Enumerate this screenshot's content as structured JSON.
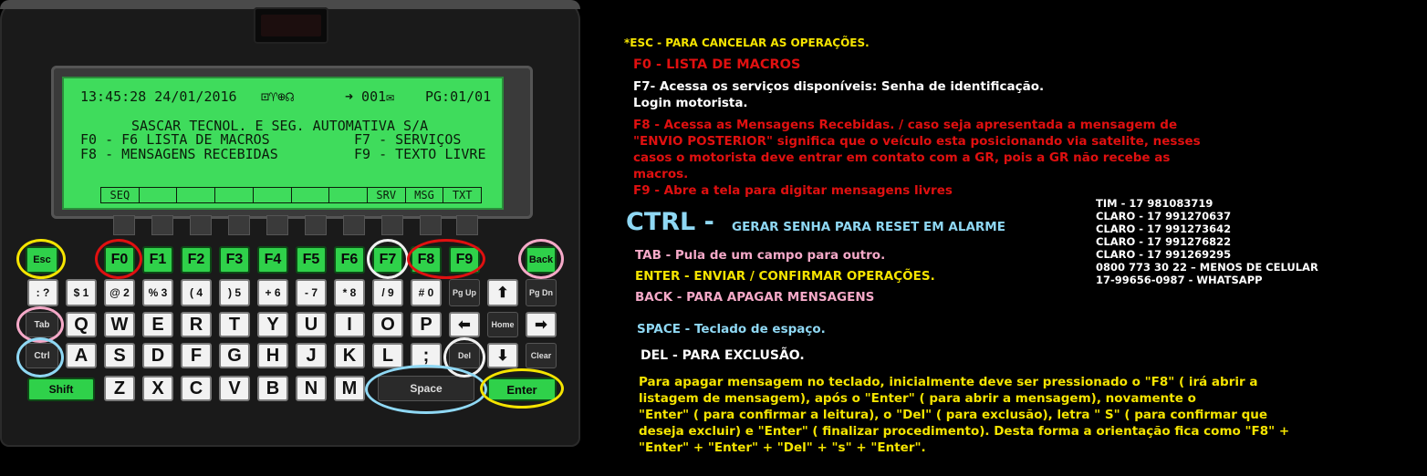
{
  "colors": {
    "yellow": "#f5e400",
    "red": "#e01010",
    "white": "#ffffff",
    "pink": "#f5a9c8",
    "lightblue": "#8fd8f4",
    "lcd": "#3fdc5c",
    "key_green": "#2fd14a"
  },
  "lcd": {
    "status_time": "13:45:28 24/01/2016",
    "status_icons": "⊡♈⊕☊",
    "status_msg": "➜ 001✉",
    "status_page": "PG:01/01",
    "line1": "SASCAR TECNOL. E SEG. AUTOMATIVA S/A",
    "line2_left": "F0 - F6 LISTA DE MACROS",
    "line2_right": "F7 - SERVIÇOS",
    "line3_left": "F8 - MENSAGENS RECEBIDAS",
    "line3_right": "F9 - TEXTO LIVRE",
    "softkeys": [
      "SEQ",
      "",
      "",
      "",
      "",
      "",
      "",
      "SRV",
      "MSG",
      "TXT"
    ]
  },
  "keys": {
    "esc": "Esc",
    "back": "Back",
    "fkeys": [
      "F0",
      "F1",
      "F2",
      "F3",
      "F4",
      "F5",
      "F6",
      "F7",
      "F8",
      "F9"
    ],
    "num_shift": [
      ":",
      "$",
      "@",
      "%",
      "(",
      "+",
      "-",
      "*",
      "/",
      "#"
    ],
    "num": [
      "",
      "1",
      "2",
      "3",
      "4",
      "5",
      "6",
      "7",
      "8",
      "9"
    ],
    "num_row": [
      {
        "s": ":",
        "m": "?"
      },
      {
        "s": "$",
        "m": "1"
      },
      {
        "s": "@",
        "m": "2"
      },
      {
        "s": "%",
        "m": "3"
      },
      {
        "s": "(",
        "m": "4"
      },
      {
        "s": ")",
        "m": "5"
      },
      {
        "s": "+",
        "m": "6"
      },
      {
        "s": "-",
        "m": "7"
      },
      {
        "s": "*",
        "m": "8"
      },
      {
        "s": "/",
        "m": "9"
      },
      {
        "s": "#",
        "m": "0"
      }
    ],
    "pgup": "Pg Up",
    "pgdn": "Pg Dn",
    "tab": "Tab",
    "row_q": [
      "Q",
      "W",
      "E",
      "R",
      "T",
      "Y",
      "U",
      "I",
      "O",
      "P"
    ],
    "home": "Home",
    "ctrl": "Ctrl",
    "row_a": [
      "A",
      "S",
      "D",
      "F",
      "G",
      "H",
      "J",
      "K",
      "L"
    ],
    "semicolon": ";",
    "del": "Del",
    "clear": "Clear",
    "shift": "Shift",
    "row_z": [
      "Z",
      "X",
      "C",
      "V",
      "B",
      "N",
      "M"
    ],
    "space": "Space",
    "enter": "Enter"
  },
  "help": {
    "esc": "*ESC - PARA CANCELAR AS OPERAÇÕES.",
    "f0": "F0 - LISTA DE MACROS",
    "f7_1": "F7-  Acessa os serviços disponíveis: Senha de identificação.",
    "f7_2": "Login motorista.",
    "f8_1": "F8 - Acessa as Mensagens Recebidas.  / caso seja apresentada a mensagem de",
    "f8_2": "\"ENVIO POSTERIOR\" significa que o veículo esta posicionando via satelite, nesses",
    "f8_3": "casos o motorista deve entrar em contato com a GR, pois a GR não recebe as",
    "f8_4": "macros.",
    "f9": "F9 - Abre a tela para digitar mensagens livres",
    "ctrl_big": "CTRL -",
    "ctrl_desc": "GERAR SENHA PARA RESET EM ALARME",
    "tab": "TAB - Pula de um campo para outro.",
    "enter": "ENTER - ENVIAR / CONFIRMAR OPERAÇÕES.",
    "back": "BACK - PARA APAGAR MENSAGENS",
    "space": "SPACE - Teclado de espaço.",
    "del": "DEL - PARA EXCLUSÃO.",
    "procedure": [
      "Para apagar mensagem no teclado, inicialmente deve ser pressionado o \"F8\" ( irá abrir a",
      "listagem de mensagem), após o \"Enter\" ( para abrir a mensagem), novamente o",
      "\"Enter\" ( para confirmar a leitura), o \"Del\" ( para exclusão), letra \" S\" ( para confirmar que",
      "deseja excluir) e \"Enter\" ( finalizar procedimento). Desta forma a orientação fica como \"F8\" +",
      "\"Enter\" + \"Enter\" + \"Del\" + \"s\" + \"Enter\"."
    ]
  },
  "contacts": [
    "TIM - 17 981083719",
    "CLARO - 17 991270637",
    "CLARO - 17 991273642",
    "CLARO - 17 991276822",
    "CLARO - 17 991269295",
    "0800 773 30 22 – MENOS DE CELULAR",
    "17-99656-0987 - WHATSAPP"
  ]
}
